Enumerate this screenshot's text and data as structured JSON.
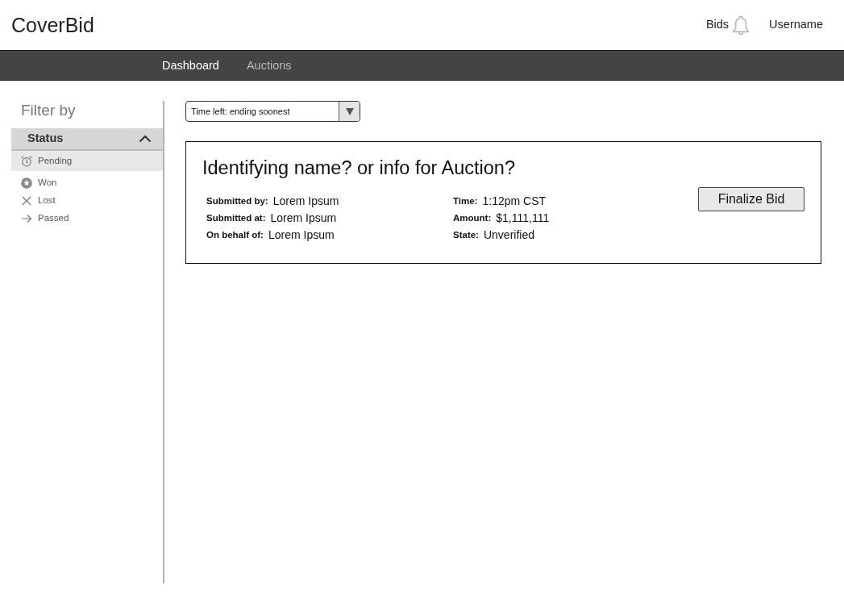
{
  "header": {
    "brand": "CoverBid",
    "bids_label": "Bids",
    "user_label": "Username"
  },
  "nav": [
    {
      "label": "Dashboard",
      "selected": true
    },
    {
      "label": "Auctions",
      "selected": false
    }
  ],
  "sidebar": {
    "title": "Filter by",
    "section": {
      "label": "Status",
      "expanded": true,
      "items": [
        {
          "label": "Pending",
          "kind": "clock",
          "selected": true
        },
        {
          "label": "Won",
          "kind": "star",
          "selected": false
        },
        {
          "label": "Lost",
          "kind": "cross",
          "selected": false
        },
        {
          "label": "Passed",
          "kind": "arrow",
          "selected": false
        }
      ]
    }
  },
  "sort_select": {
    "value": "Time left: ending soonest"
  },
  "bids": [
    {
      "title": "Identifying name? or info for Auction?",
      "fields_left": [
        {
          "label": "Submitted by:",
          "value": "Lorem Ipsum"
        },
        {
          "label": "Submitted at:",
          "value": "Lorem Ipsum"
        },
        {
          "label": "On behalf of:",
          "value": "Lorem Ipsum"
        }
      ],
      "fields_right": [
        {
          "label": "Time:",
          "value": "1:12pm CST"
        },
        {
          "label": "Amount:",
          "value": "$1,111,111"
        },
        {
          "label": "State:",
          "value": "Unverified"
        }
      ],
      "action": "Finalize Bid"
    }
  ]
}
